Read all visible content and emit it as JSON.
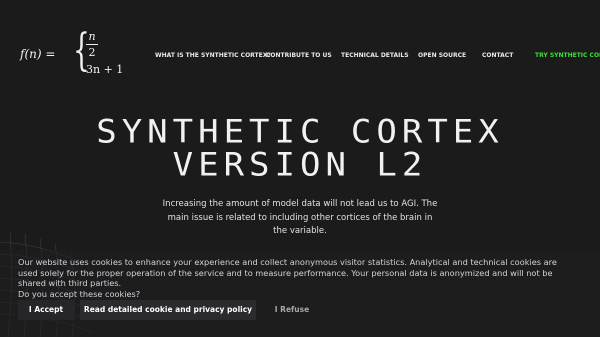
{
  "logo": {
    "fn": "f(n) =",
    "case1_num": "n",
    "case1_den": "2",
    "case2": "3n + 1"
  },
  "nav": {
    "items": [
      "WHAT IS THE SYNTHETIC CORTEX?",
      "CONTRIBUTE TO US",
      "TECHNICAL DETAILS",
      "OPEN SOURCE",
      "CONTACT"
    ],
    "cta": "TRY SYNTHETIC CORTEX",
    "cta_color": "#3ae03a"
  },
  "hero": {
    "title_line1": "SYNTHETIC CORTEX",
    "title_line2": "VERSION L2",
    "lead": "Increasing the amount of model data will not lead us to AGI. The main issue is related to including other cortices of the brain in the variable."
  },
  "cookie": {
    "text_line1": "Our website uses cookies to enhance your experience and collect anonymous visitor statistics. Analytical and technical cookies are used solely for the proper operation of the service and to measure performance. Your personal data is anonymized and will not be shared with third parties.",
    "text_line2": "Do you accept these cookies?",
    "accept_label": "I Accept",
    "policy_label": "Read detailed cookie and privacy policy",
    "refuse_label": "I Refuse"
  },
  "colors": {
    "background": "#1b1b1b",
    "text": "#e6e6e6",
    "accent": "#3ae03a"
  }
}
